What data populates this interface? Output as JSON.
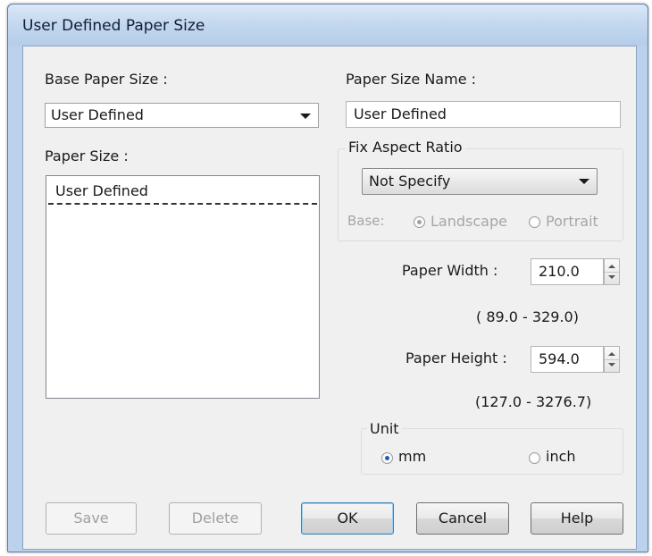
{
  "window": {
    "title": "User Defined Paper Size"
  },
  "base_paper_size": {
    "label": "Base Paper Size :",
    "value": "User Defined"
  },
  "paper_size_name": {
    "label": "Paper Size Name :",
    "value": "User Defined"
  },
  "paper_size_list": {
    "label": "Paper Size :",
    "items": [
      "User Defined"
    ]
  },
  "fix_aspect_ratio": {
    "label": "Fix Aspect Ratio",
    "value": "Not Specify",
    "base_label": "Base:",
    "landscape_label": "Landscape",
    "portrait_label": "Portrait",
    "selected": "Landscape"
  },
  "paper_width": {
    "label": "Paper Width :",
    "value": "210.0",
    "range": "( 89.0 - 329.0)"
  },
  "paper_height": {
    "label": "Paper Height :",
    "value": "594.0",
    "range": "(127.0 - 3276.7)"
  },
  "unit": {
    "label": "Unit",
    "mm_label": "mm",
    "inch_label": "inch",
    "selected": "mm"
  },
  "buttons": {
    "save": "Save",
    "delete": "Delete",
    "ok": "OK",
    "cancel": "Cancel",
    "help": "Help"
  },
  "colors": {
    "title_bar": "#c4d8ef",
    "dialog_background": "#f0f0f0",
    "radio_checked": "#1f5bb5",
    "disabled_text": "#a6a6a6"
  }
}
